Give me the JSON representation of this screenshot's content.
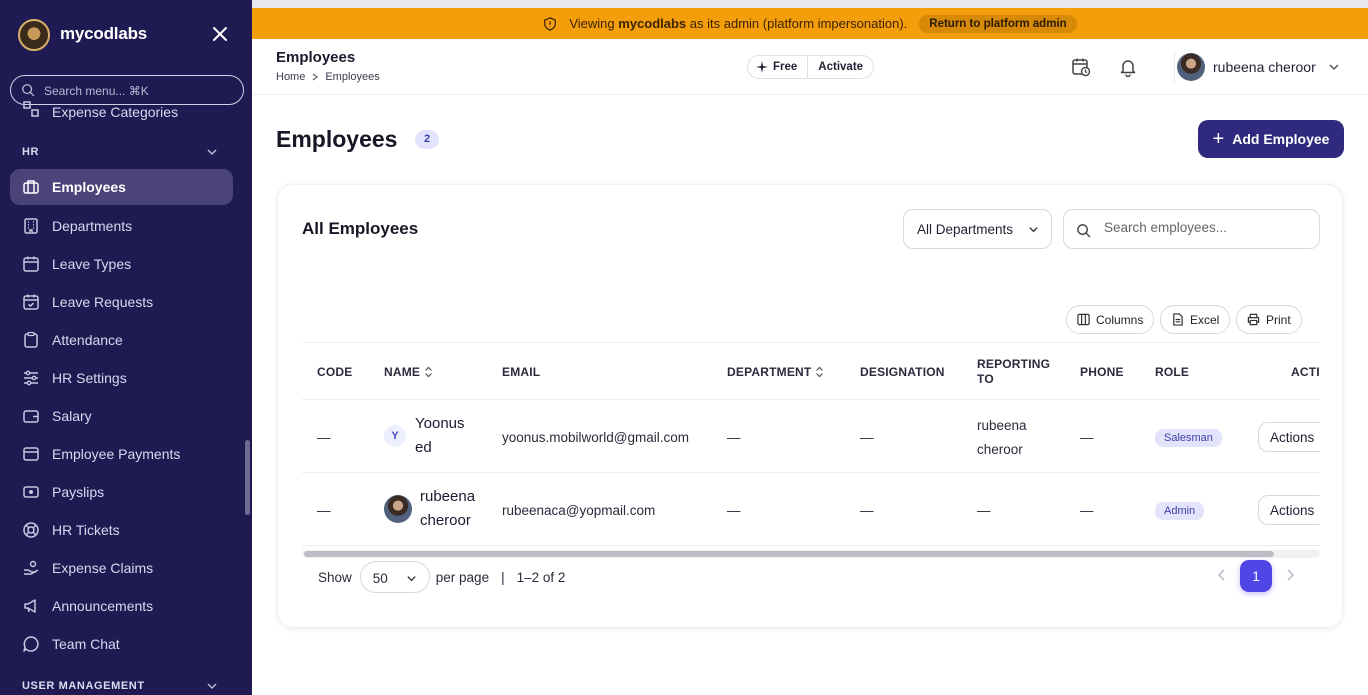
{
  "sidebar": {
    "brand": "mycodlabs",
    "search_placeholder": "Search menu... ⌘K",
    "partial_item": "Expense Categories",
    "section_hr": "HR",
    "items": [
      {
        "label": "Employees",
        "icon": "briefcase-icon",
        "active": true
      },
      {
        "label": "Departments",
        "icon": "building-icon"
      },
      {
        "label": "Leave Types",
        "icon": "calendar-icon"
      },
      {
        "label": "Leave Requests",
        "icon": "calendar-check-icon"
      },
      {
        "label": "Attendance",
        "icon": "clipboard-icon"
      },
      {
        "label": "HR Settings",
        "icon": "sliders-icon"
      },
      {
        "label": "Salary",
        "icon": "wallet-icon"
      },
      {
        "label": "Employee Payments",
        "icon": "document-icon"
      },
      {
        "label": "Payslips",
        "icon": "payslip-icon"
      },
      {
        "label": "HR Tickets",
        "icon": "lifebuoy-icon"
      },
      {
        "label": "Expense Claims",
        "icon": "hand-coins-icon"
      },
      {
        "label": "Announcements",
        "icon": "megaphone-icon"
      },
      {
        "label": "Team Chat",
        "icon": "chat-icon"
      }
    ],
    "section_user_mgmt": "USER MANAGEMENT"
  },
  "banner": {
    "prefix": "Viewing",
    "org": "mycodlabs",
    "suffix": "as its admin (platform impersonation).",
    "return_label": "Return to platform admin"
  },
  "header": {
    "title": "Employees",
    "breadcrumb": [
      "Home",
      "Employees"
    ],
    "plan_label": "Free",
    "activate_label": "Activate",
    "user_name": "rubeena cheroor"
  },
  "main": {
    "title": "Employees",
    "count": "2",
    "add_label": "Add Employee",
    "card_title": "All Employees",
    "dept_filter": "All Departments",
    "search_placeholder": "Search employees...",
    "tools": [
      "Columns",
      "Excel",
      "Print"
    ]
  },
  "table": {
    "columns": [
      "CODE",
      "NAME",
      "EMAIL",
      "DEPARTMENT",
      "DESIGNATION",
      "REPORTING",
      "TO",
      "PHONE",
      "ROLE",
      "ACTI"
    ],
    "rows": [
      {
        "code": "—",
        "initial": "Y",
        "name_line1": "Yoonus",
        "name_line2": "ed",
        "email": "yoonus.mobilworld@gmail.com",
        "department": "—",
        "designation": "—",
        "reporting_line1": "rubeena",
        "reporting_line2": "cheroor",
        "phone": "—",
        "role": "Salesman",
        "actions": "Actions"
      },
      {
        "code": "—",
        "name_line1": "rubeena",
        "name_line2": "cheroor",
        "email": "rubeenaca@yopmail.com",
        "department": "—",
        "designation": "—",
        "reporting": "—",
        "phone": "—",
        "role": "Admin",
        "actions": "Actions"
      }
    ]
  },
  "pagination": {
    "show_label": "Show",
    "per_page_value": "50",
    "per_page_label": "per page",
    "separator": "|",
    "range": "1–2 of 2",
    "current_page": "1"
  },
  "colors": {
    "sidebar_bg": "#1f1a52",
    "banner_bg": "#f59e0b",
    "primary": "#2f2a7e",
    "page_active": "#4f46e5"
  }
}
